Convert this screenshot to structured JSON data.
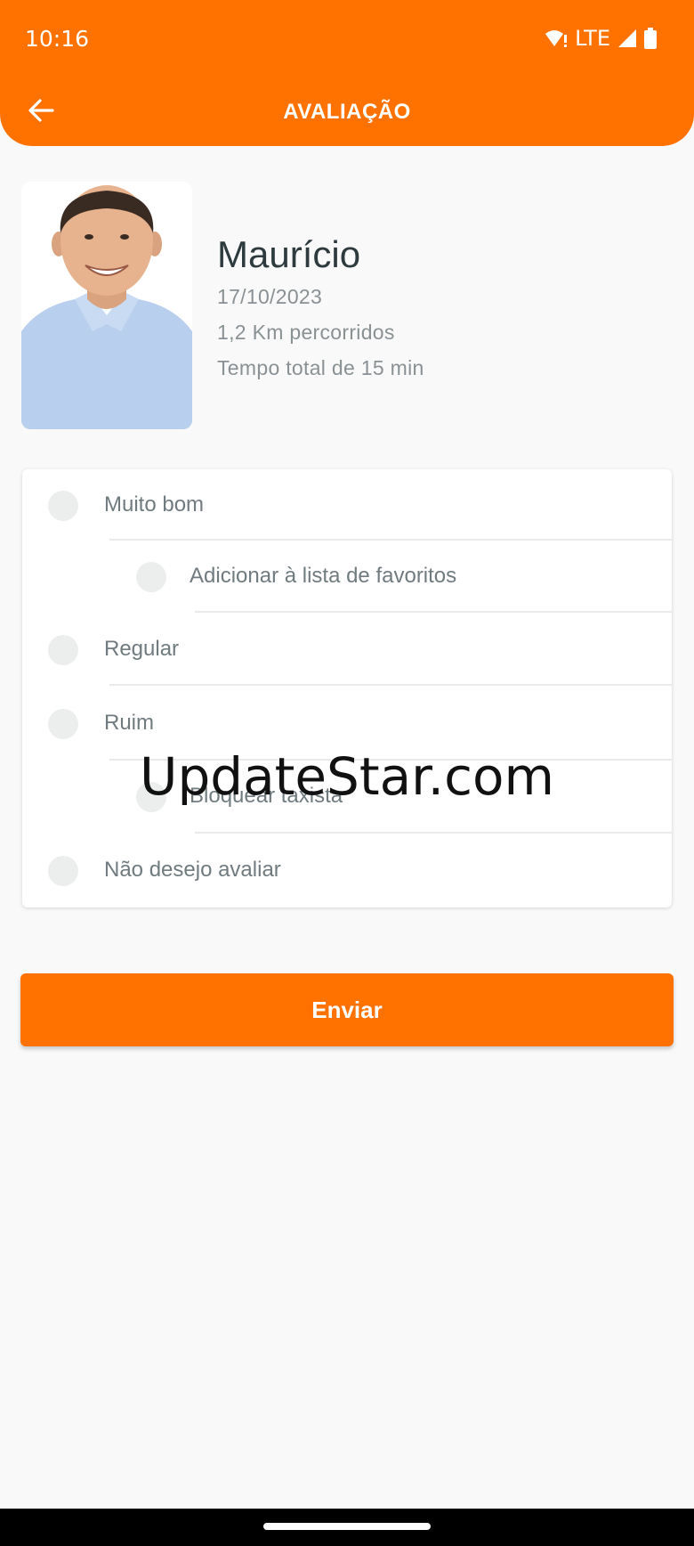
{
  "status_bar": {
    "time": "10:16",
    "network_label": "LTE",
    "icons": [
      "wifi-alert-icon",
      "signal-icon",
      "battery-icon"
    ]
  },
  "header": {
    "title": "AVALIAÇÃO",
    "back_icon": "arrow-left-icon",
    "background_color": "#ff7200"
  },
  "driver": {
    "name": "Maurício",
    "date": "17/10/2023",
    "distance": "1,2 Km percorridos",
    "duration": "Tempo total de 15 min"
  },
  "rating": {
    "options": [
      {
        "label": "Muito bom",
        "selected": false
      },
      {
        "label": "Adicionar à lista de favoritos",
        "selected": false
      },
      {
        "label": "Regular",
        "selected": false
      },
      {
        "label": "Ruim",
        "selected": false
      },
      {
        "label": "Bloquear taxista",
        "selected": false
      },
      {
        "label": "Não desejo avaliar",
        "selected": false
      }
    ]
  },
  "submit": {
    "label": "Enviar",
    "color": "#ff7200"
  },
  "watermark": "UpdateStar.com"
}
